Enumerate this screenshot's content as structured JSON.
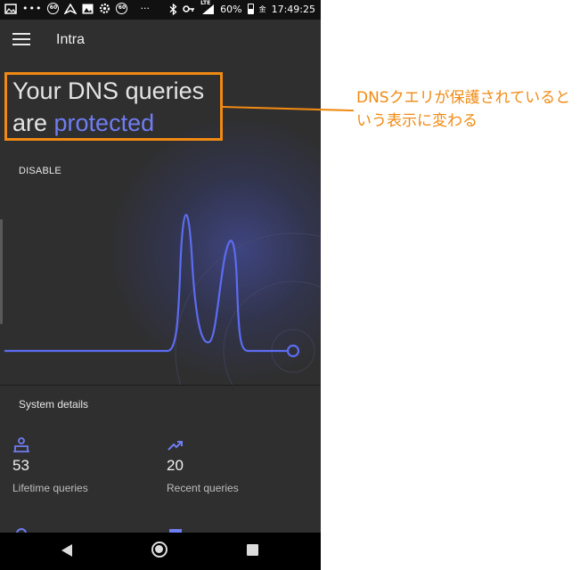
{
  "status_bar": {
    "time": "17:49:25",
    "battery_percent": "60%",
    "network_badge": "LTE",
    "left_badge_1": "60",
    "left_badge_2": "60",
    "overflow": "···",
    "left_icons": [
      "gallery-icon",
      "dots-icon",
      "badge-60-icon",
      "airplane-mode-icon",
      "image-icon",
      "settings-icon",
      "badge-60-icon",
      "overflow-icon"
    ],
    "right_icons": [
      "bluetooth-icon",
      "key-icon",
      "signal-icon",
      "battery-icon"
    ]
  },
  "app_bar": {
    "title": "Intra",
    "menu_icon": "hamburger-menu-icon"
  },
  "hero": {
    "headline_prefix": "Your DNS queries are ",
    "headline_accent": "protected",
    "disable_label": "DISABLE",
    "accent_color": "#6f7df1",
    "highlight_color": "#f08a12"
  },
  "details": {
    "title": "System details",
    "stats": [
      {
        "value": "53",
        "label": "Lifetime queries",
        "icon": "lifetime-queries-icon"
      },
      {
        "value": "20",
        "label": "Recent queries",
        "icon": "trending-up-icon"
      }
    ]
  },
  "annotation": {
    "text": "DNSクエリが保護されているという表示に変わる",
    "color": "#f08a12"
  },
  "nav_bar": {
    "icons": [
      "back-icon",
      "home-icon",
      "recent-apps-icon"
    ]
  }
}
